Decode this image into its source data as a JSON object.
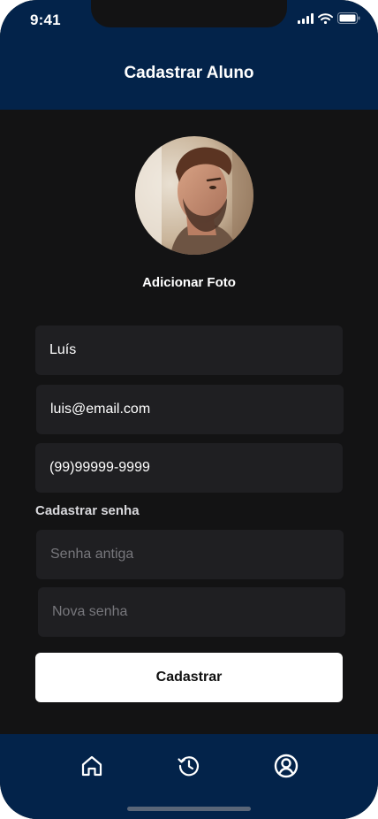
{
  "status_bar": {
    "time": "9:41",
    "icons": [
      "signal-icon",
      "wifi-icon",
      "battery-icon"
    ]
  },
  "header": {
    "title": "Cadastrar Aluno"
  },
  "profile": {
    "add_photo_label": "Adicionar Foto"
  },
  "form": {
    "name_value": "Luís",
    "email_value": "luis@email.com",
    "phone_value": "(99)99999-9999",
    "password_section_label": "Cadastrar senha",
    "old_password_placeholder": "Senha antiga",
    "new_password_placeholder": "Nova senha",
    "submit_label": "Cadastrar"
  },
  "tabbar": {
    "items": [
      {
        "icon": "home-icon"
      },
      {
        "icon": "history-icon"
      },
      {
        "icon": "profile-icon"
      }
    ]
  },
  "colors": {
    "header_bg": "#03234a",
    "screen_bg": "#131314",
    "field_bg": "#1f1f22",
    "button_bg": "#ffffff"
  }
}
